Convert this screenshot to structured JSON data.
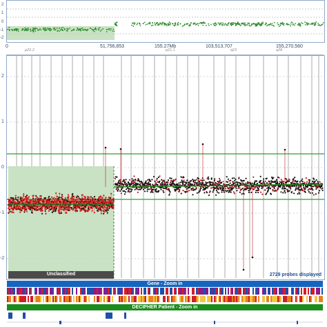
{
  "overview": {
    "ticks": [
      "2",
      "1",
      "0",
      "-1",
      "-2"
    ]
  },
  "coords": {
    "c0": "0",
    "c1": "51,756,853",
    "c2": "155.27Mb",
    "c3": "103,513,707",
    "c4": "155,270,560"
  },
  "bands": [
    "p22.2",
    "p21.1",
    "q23",
    "q28"
  ],
  "main_plot": {
    "y_ticks": [
      "2",
      "1",
      "0",
      "-1",
      "-2"
    ],
    "region_label": "Unclassified",
    "probes_text": "2729 probes displayed"
  },
  "tracks": {
    "gene_label": "Gene - Zoom in",
    "decipher_label": "DECIPHER Patient - Zoom in"
  },
  "colors": {
    "region_fill": "#c9e2c3",
    "track_blue": "#1565c0",
    "track_green": "#1c8c1c",
    "probe_red": "#d01c1c",
    "probe_black": "#111111",
    "threshold_green": "#2e9e2e"
  }
}
